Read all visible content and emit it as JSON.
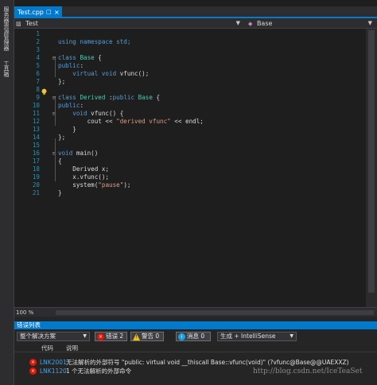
{
  "side_toolbar": {
    "items": [
      {
        "label": "服务器资源管理器"
      },
      {
        "label": "工具箱"
      }
    ]
  },
  "tabs": [
    {
      "label": "Test.cpp",
      "pin_icon": "pin-icon",
      "close_icon": "close-icon",
      "active": true
    }
  ],
  "navbar": {
    "scope": "Test",
    "member": "Base"
  },
  "editor": {
    "lines": [
      {
        "n": "1",
        "fold": "",
        "tokens": []
      },
      {
        "n": "2",
        "fold": "",
        "tokens": [
          {
            "t": "using namespace std;",
            "c": "kwline"
          }
        ]
      },
      {
        "n": "3",
        "fold": "",
        "tokens": []
      },
      {
        "n": "4",
        "fold": "⊟",
        "tokens": [
          {
            "t": "class",
            "c": "kw"
          },
          {
            "t": " ",
            "c": ""
          },
          {
            "t": "Base",
            "c": "cls"
          },
          {
            "t": " {",
            "c": ""
          }
        ]
      },
      {
        "n": "5",
        "fold": "",
        "tokens": [
          {
            "t": "public",
            "c": "kw"
          },
          {
            "t": ":",
            "c": ""
          }
        ]
      },
      {
        "n": "6",
        "fold": "",
        "tokens": [
          {
            "t": "    virtual void",
            "c": "kw"
          },
          {
            "t": " vfunc();",
            "c": ""
          }
        ]
      },
      {
        "n": "7",
        "fold": "",
        "tokens": [
          {
            "t": "};",
            "c": ""
          }
        ]
      },
      {
        "n": "8",
        "fold": "",
        "tokens": []
      },
      {
        "n": "9",
        "fold": "⊟",
        "tokens": [
          {
            "t": "class",
            "c": "kw"
          },
          {
            "t": " ",
            "c": ""
          },
          {
            "t": "Derived",
            "c": "cls"
          },
          {
            "t": " :",
            "c": ""
          },
          {
            "t": "public",
            "c": "kw"
          },
          {
            "t": " ",
            "c": ""
          },
          {
            "t": "Base",
            "c": "cls"
          },
          {
            "t": " {",
            "c": ""
          }
        ]
      },
      {
        "n": "10",
        "fold": "",
        "tokens": [
          {
            "t": "public",
            "c": "kw"
          },
          {
            "t": ":",
            "c": ""
          }
        ]
      },
      {
        "n": "11",
        "fold": "⊟",
        "tokens": [
          {
            "t": "    void",
            "c": "kw"
          },
          {
            "t": " vfunc() {",
            "c": ""
          }
        ]
      },
      {
        "n": "12",
        "fold": "",
        "tokens": [
          {
            "t": "        cout << ",
            "c": ""
          },
          {
            "t": "\"derived vfunc\"",
            "c": "str"
          },
          {
            "t": " << endl;",
            "c": ""
          }
        ]
      },
      {
        "n": "13",
        "fold": "",
        "tokens": [
          {
            "t": "    }",
            "c": ""
          }
        ]
      },
      {
        "n": "14",
        "fold": "",
        "tokens": [
          {
            "t": "};",
            "c": ""
          }
        ]
      },
      {
        "n": "15",
        "fold": "",
        "tokens": []
      },
      {
        "n": "16",
        "fold": "⊟",
        "tokens": [
          {
            "t": "void",
            "c": "kw"
          },
          {
            "t": " main()",
            "c": ""
          }
        ]
      },
      {
        "n": "17",
        "fold": "",
        "tokens": [
          {
            "t": "{",
            "c": ""
          }
        ]
      },
      {
        "n": "18",
        "fold": "",
        "tokens": [
          {
            "t": "    Derived x;",
            "c": ""
          }
        ]
      },
      {
        "n": "19",
        "fold": "",
        "tokens": [
          {
            "t": "    x.vfunc();",
            "c": ""
          }
        ]
      },
      {
        "n": "20",
        "fold": "",
        "tokens": [
          {
            "t": "    system(",
            "c": ""
          },
          {
            "t": "\"pause\"",
            "c": "str"
          },
          {
            "t": ");",
            "c": ""
          }
        ]
      },
      {
        "n": "21",
        "fold": "",
        "tokens": [
          {
            "t": "}",
            "c": ""
          }
        ]
      }
    ]
  },
  "zoom": "100 %",
  "error_list": {
    "title": "错误列表",
    "scope_dropdown": "整个解决方案",
    "errors_filter": "错误 2",
    "warnings_filter": "警告 0",
    "messages_filter": "消息 0",
    "build_dropdown": "生成 + IntelliSense",
    "col_code": "代码",
    "col_desc": "说明",
    "rows": [
      {
        "code": "LNK2001",
        "desc": "无法解析的外部符号 \"public: virtual void __thiscall Base::vfunc(void)\" (?vfunc@Base@@UAEXXZ)"
      },
      {
        "code": "LNK1120",
        "desc": "1 个无法解析的外部命令"
      }
    ],
    "watermark": "http://blog.csdn.net/IceTeaSet"
  }
}
